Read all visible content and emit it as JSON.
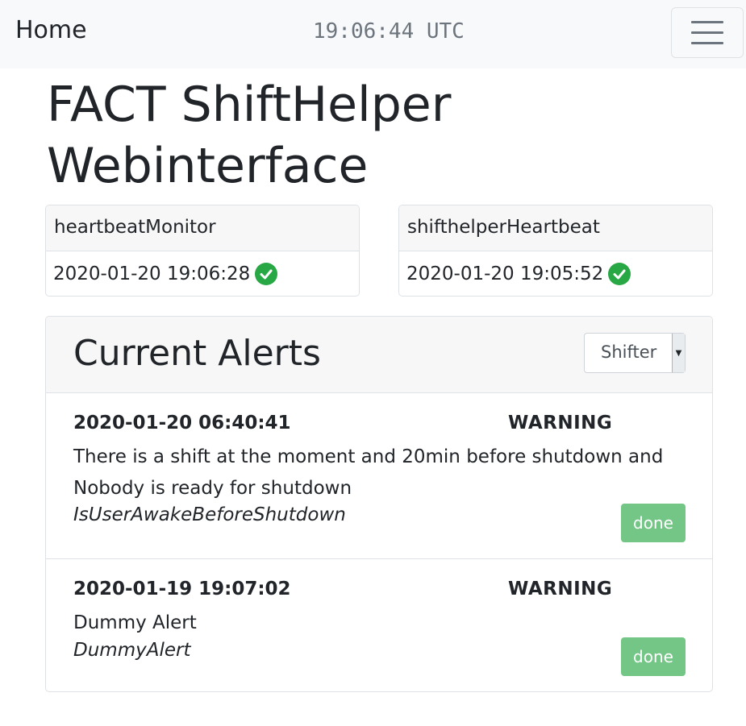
{
  "navbar": {
    "brand": "Home",
    "clock": "19:06:44 UTC",
    "toggler_icon": "hamburger-menu-icon"
  },
  "page": {
    "title": "FACT ShiftHelper Webinterface"
  },
  "heartbeats": [
    {
      "name": "heartbeatMonitor",
      "timestamp": "2020-01-20 19:06:28",
      "status": "ok",
      "icon": "check-circle-icon"
    },
    {
      "name": "shifthelperHeartbeat",
      "timestamp": "2020-01-20 19:05:52",
      "status": "ok",
      "icon": "check-circle-icon"
    }
  ],
  "alerts": {
    "title": "Current Alerts",
    "role_select": {
      "value": "Shifter"
    },
    "items": [
      {
        "time": "2020-01-20 06:40:41",
        "level": "WARNING",
        "text": "There is a shift at the moment and 20min before shutdown and Nobody is ready for shutdown",
        "name": "IsUserAwakeBeforeShutdown",
        "button": "done"
      },
      {
        "time": "2020-01-19 19:07:02",
        "level": "WARNING",
        "text": "Dummy Alert",
        "name": "DummyAlert",
        "button": "done"
      }
    ]
  },
  "colors": {
    "navbar_bg": "#f8f9fa",
    "success": "#28a745",
    "done_button": "#74c687"
  }
}
